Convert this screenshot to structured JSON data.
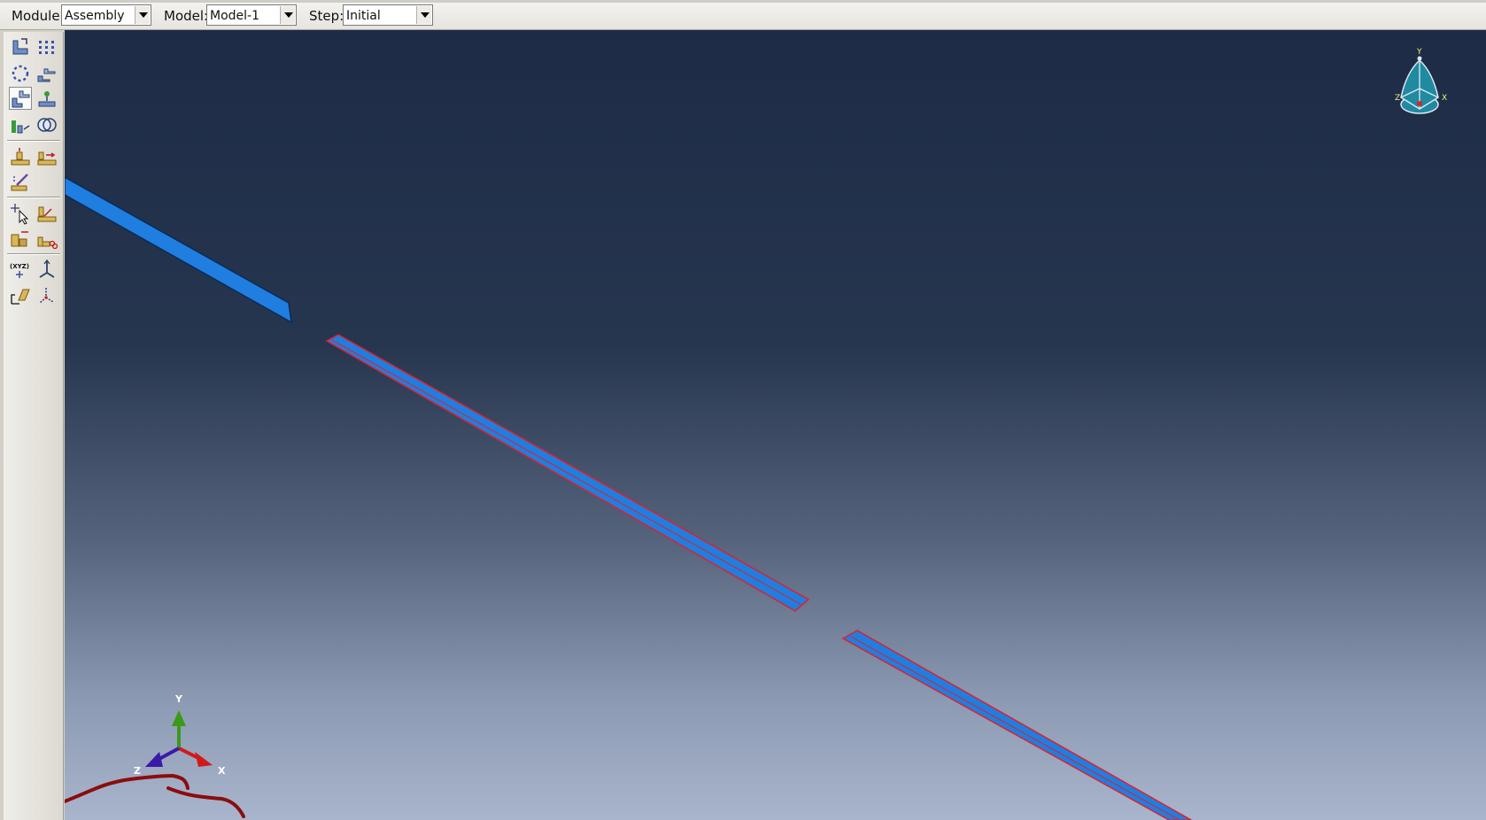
{
  "context_bar": {
    "module": {
      "label": "Module:",
      "value": "Assembly"
    },
    "model": {
      "label": "Model:",
      "value": "Model-1"
    },
    "step": {
      "label": "Step:",
      "value": "Initial"
    }
  },
  "toolbox": {
    "tools": [
      {
        "name": "create-instance-icon"
      },
      {
        "name": "linear-pattern-icon"
      },
      {
        "name": "radial-pattern-icon"
      },
      {
        "name": "translate-instance-icon"
      },
      {
        "name": "rotate-instance-icon"
      },
      {
        "name": "translate-to-icon"
      },
      {
        "name": "convert-constraints-icon"
      },
      {
        "name": "merge-cut-instances-icon"
      },
      {
        "name": "parallel-face-icon"
      },
      {
        "name": "face-to-face-icon"
      },
      {
        "name": "edit-constraint-icon"
      },
      {
        "name": "query-icon"
      },
      {
        "name": "create-set-icon"
      },
      {
        "name": "create-surface-icon"
      },
      {
        "name": "partition-icon"
      },
      {
        "name": "datum-point-icon"
      },
      {
        "name": "datum-axis-icon"
      },
      {
        "name": "datum-plane-icon"
      },
      {
        "name": "datum-csys-icon"
      }
    ]
  },
  "viewport": {
    "triad_labels": {
      "x": "X",
      "y": "Y",
      "z": "Z"
    },
    "view_cube_labels": {
      "x": "X",
      "y": "Y",
      "z": "Z"
    },
    "colors": {
      "part_fill": "#1f7ee0",
      "selected_outline": "#e0202a",
      "axis_x": "#d11a1a",
      "axis_y": "#3a9a1a",
      "axis_z": "#3a1aa8",
      "annotation": "#8b0d0d"
    }
  }
}
